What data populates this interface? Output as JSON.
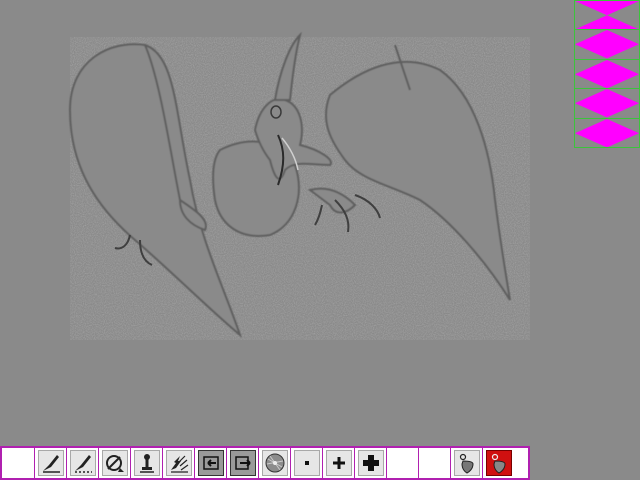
{
  "canvas": {
    "image": "pterodactyl-emboss"
  },
  "palette": {
    "swatch_color": "#ff00ff",
    "border_color": "#3cc43c",
    "swatches": [
      {
        "name": "magenta-diamond"
      },
      {
        "name": "magenta-diamond"
      },
      {
        "name": "magenta-diamond"
      },
      {
        "name": "magenta-diamond"
      },
      {
        "name": "magenta-diamond"
      }
    ]
  },
  "toolbar": {
    "border_color": "#b020b0",
    "tools": [
      {
        "icon": "blank-icon"
      },
      {
        "icon": "brush-stroke-icon"
      },
      {
        "icon": "dotted-brush-icon"
      },
      {
        "icon": "eraser-icon"
      },
      {
        "icon": "stamp-icon"
      },
      {
        "icon": "splatter-icon"
      },
      {
        "icon": "import-icon"
      },
      {
        "icon": "export-icon"
      },
      {
        "icon": "disc-icon"
      },
      {
        "icon": "small-dot-icon"
      },
      {
        "icon": "small-cross-icon"
      },
      {
        "icon": "large-cross-icon"
      },
      {
        "icon": "blank-icon"
      },
      {
        "icon": "blank-icon"
      },
      {
        "icon": "shield-icon"
      },
      {
        "icon": "shield-red-icon"
      }
    ]
  }
}
